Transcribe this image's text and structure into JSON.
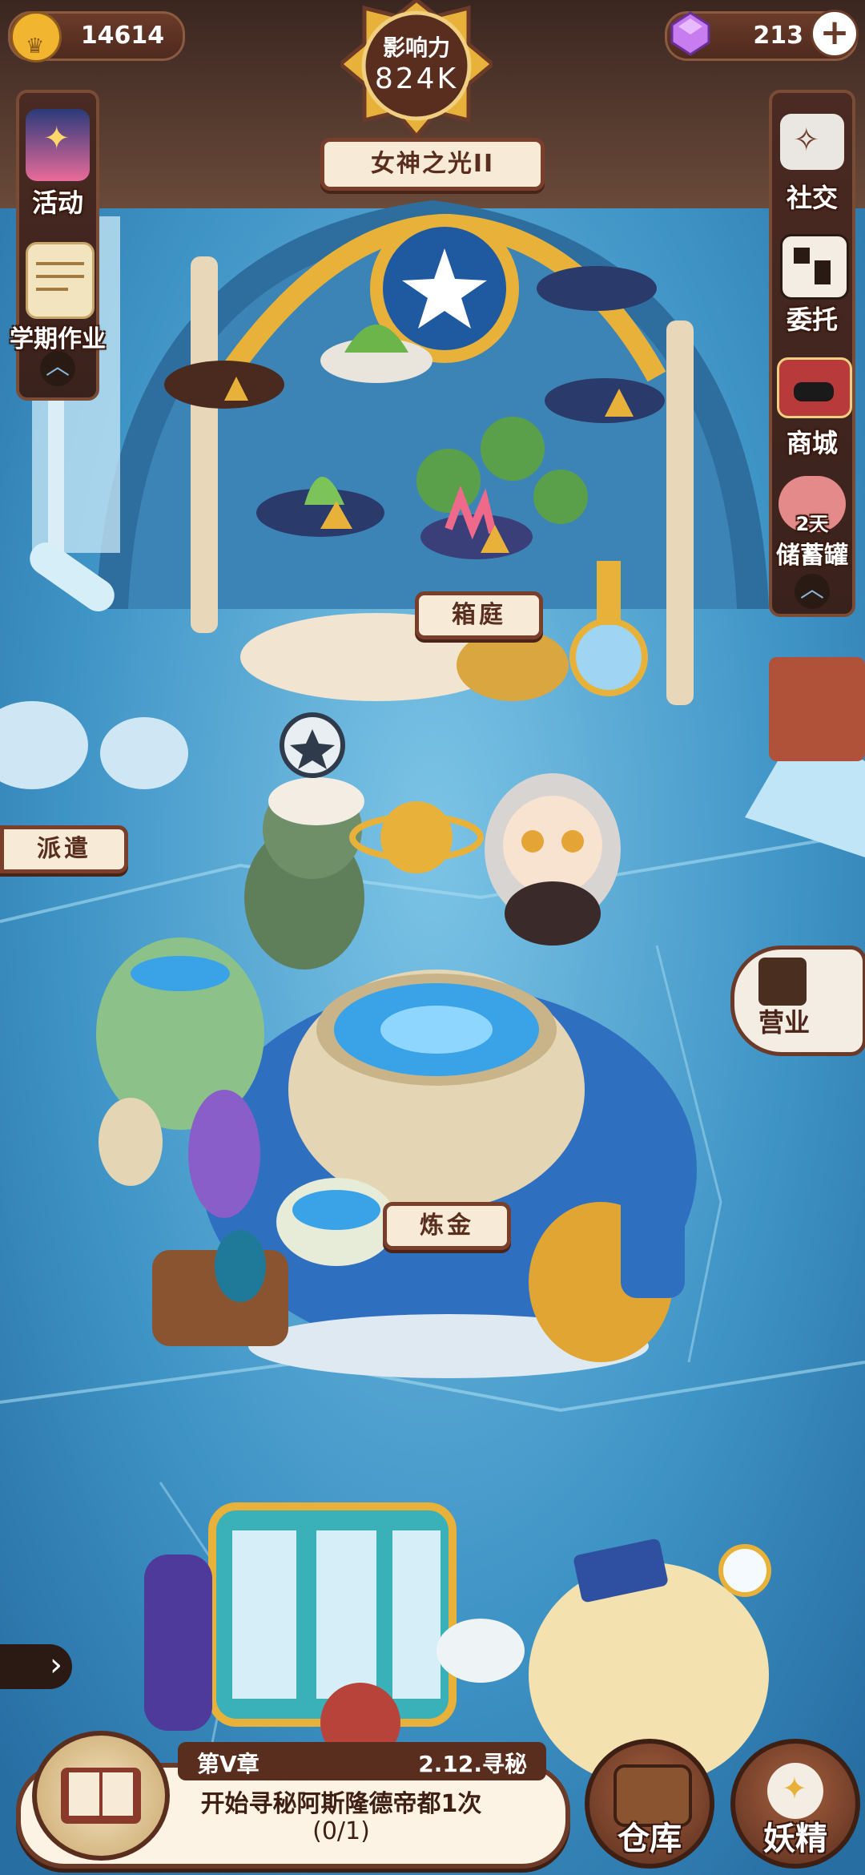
{
  "top_bar": {
    "coins": "14614",
    "gems": "213",
    "influence_label": "影响力",
    "influence_value": "824K",
    "title_plaque": "女神之光II"
  },
  "left_menu": {
    "items": [
      {
        "label": "活动",
        "icon": "fireworks-icon"
      },
      {
        "label": "学期作业",
        "icon": "scroll-icon"
      }
    ]
  },
  "right_menu": {
    "items": [
      {
        "label": "社交",
        "icon": "social-icon"
      },
      {
        "label": "委托",
        "icon": "commission-icon"
      },
      {
        "label": "商城",
        "icon": "shop-icon"
      },
      {
        "label": "储蓄罐",
        "icon": "piggy-bank-icon",
        "badge": "2天"
      }
    ]
  },
  "scene": {
    "garden_label": "箱庭",
    "dispatch_label": "派遣",
    "alchemy_label": "炼金",
    "business_label": "营业"
  },
  "quest": {
    "chapter": "第V章",
    "quest_id": "2.12.寻秘",
    "description": "开始寻秘阿斯隆德帝都1次",
    "progress": "(0/1)"
  },
  "bottom_buttons": {
    "warehouse": "仓库",
    "fairy": "妖精"
  },
  "colors": {
    "ice": "#3e8fc0",
    "wood": "#5a2e1e",
    "parchment": "#f7ead6",
    "gold": "#e8b23a"
  }
}
